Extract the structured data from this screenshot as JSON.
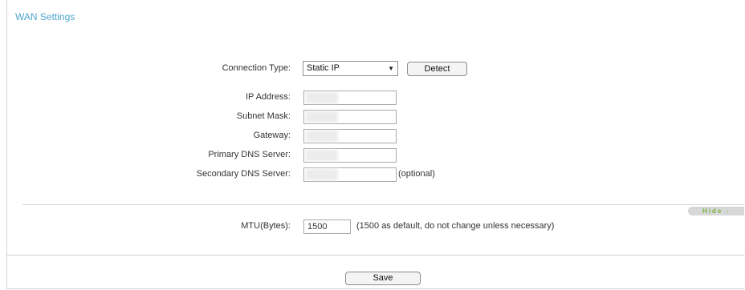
{
  "panel": {
    "title": "WAN Settings"
  },
  "connection": {
    "label": "Connection Type:",
    "selected": "Static IP",
    "detect_label": "Detect"
  },
  "fields": {
    "ip_label": "IP Address:",
    "subnet_label": "Subnet Mask:",
    "gateway_label": "Gateway:",
    "primary_dns_label": "Primary DNS Server:",
    "secondary_dns_label": "Secondary DNS Server:",
    "optional_note": "(optional)"
  },
  "advanced": {
    "hide_label": "Hide -",
    "mtu_label": "MTU(Bytes):",
    "mtu_value": "1500",
    "mtu_note": "(1500 as default, do not change unless necessary)"
  },
  "actions": {
    "save_label": "Save"
  },
  "colors": {
    "title": "#4fa4cf",
    "hide_text": "#7cb342",
    "hide_bg": "#d7d7d7"
  }
}
